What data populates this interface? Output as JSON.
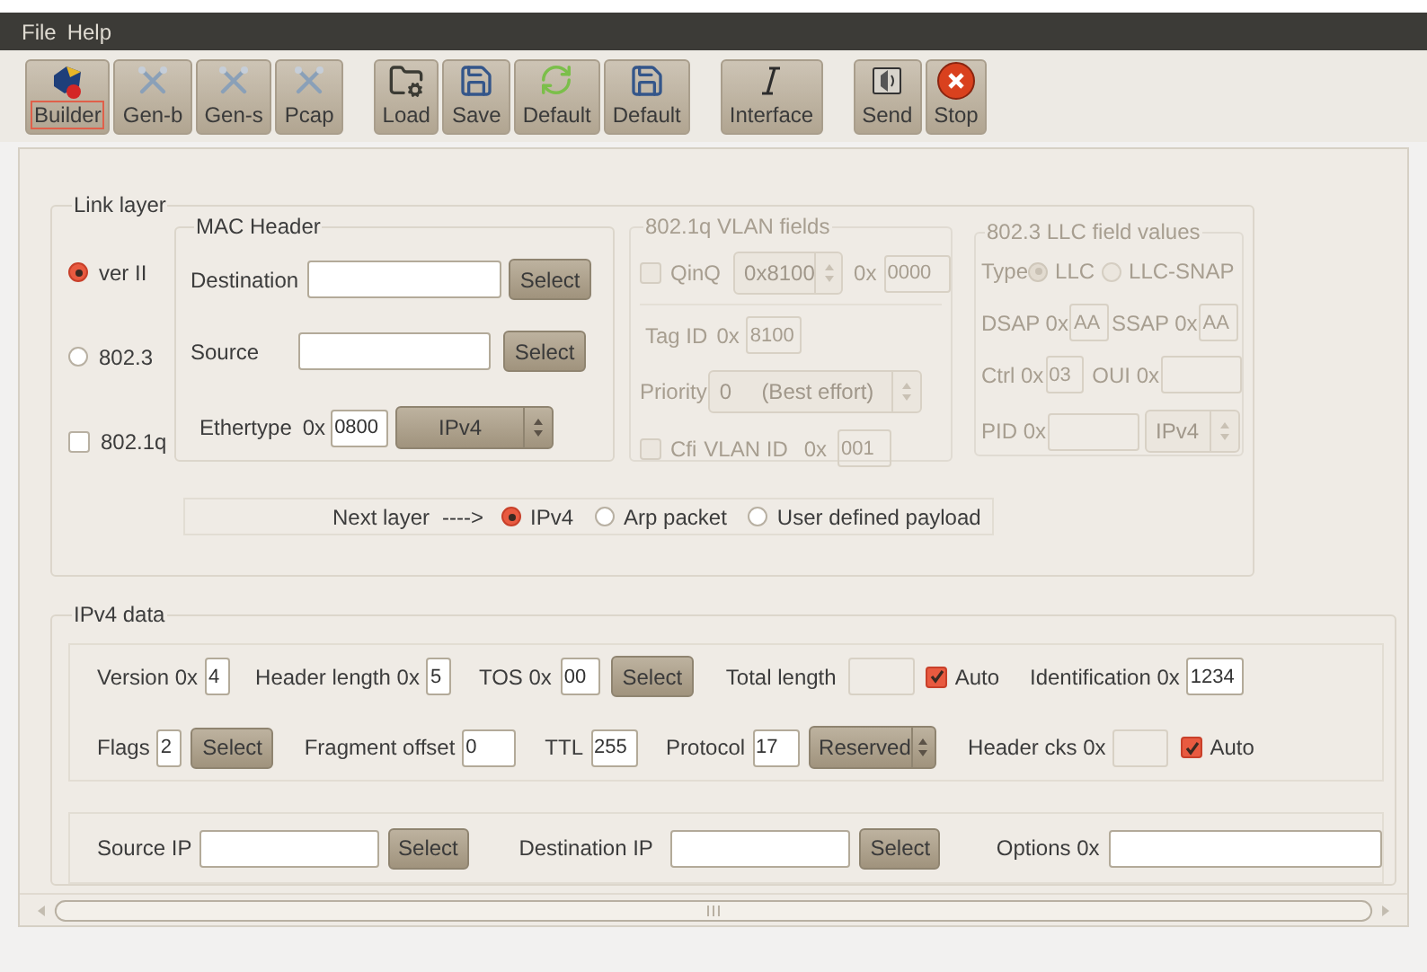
{
  "menu": [
    "File",
    "Help"
  ],
  "toolbar_groups": [
    [
      {
        "label": "Builder",
        "selected": true
      },
      {
        "label": "Gen-b",
        "selected": false
      },
      {
        "label": "Gen-s",
        "selected": false
      },
      {
        "label": "Pcap",
        "selected": false
      }
    ],
    [
      {
        "label": "Load",
        "selected": false
      },
      {
        "label": "Save",
        "selected": false
      },
      {
        "label": "Default",
        "selected": false
      },
      {
        "label": "Default",
        "selected": false
      }
    ],
    [
      {
        "label": "Interface",
        "selected": false
      }
    ],
    [
      {
        "label": "Send",
        "selected": false
      },
      {
        "label": "Stop",
        "selected": false
      }
    ]
  ],
  "link_layer": {
    "title": "Link layer",
    "options": [
      {
        "kind": "radio",
        "label": "ver II",
        "checked": true
      },
      {
        "kind": "radio",
        "label": "802.3",
        "checked": false
      },
      {
        "kind": "checkbox",
        "label": "802.1q",
        "checked": false
      }
    ],
    "mac_header": {
      "title": "MAC Header",
      "destination": {
        "label": "Destination",
        "button": "Select"
      },
      "source": {
        "label": "Source",
        "button": "Select"
      },
      "ethertype": {
        "label": "Ethertype",
        "prefix": "0x",
        "value": "0800",
        "combo": "IPv4"
      }
    },
    "vlan": {
      "title": "802.1q VLAN fields",
      "disabled": true,
      "qinq": {
        "label": "QinQ",
        "checked": false,
        "combo": "0x8100",
        "prefix": "0x",
        "value": "0000"
      },
      "tag_id": {
        "label": "Tag ID",
        "prefix": "0x",
        "value": "8100"
      },
      "priority": {
        "label": "Priority",
        "combo": "0     (Best effort)"
      },
      "cfi": {
        "label": "Cfi",
        "checked": false
      },
      "vlan_id": {
        "label": "VLAN ID",
        "prefix": "0x",
        "value": "001"
      }
    },
    "llc": {
      "title": "802.3 LLC field values",
      "disabled": true,
      "type_label": "Type",
      "types": [
        {
          "label": "LLC",
          "selected": true
        },
        {
          "label": "LLC-SNAP",
          "selected": false
        }
      ],
      "dsap": {
        "label": "DSAP 0x",
        "value": "AA"
      },
      "ssap": {
        "label": "SSAP 0x",
        "value": "AA"
      },
      "ctrl": {
        "label": "Ctrl 0x",
        "value": "03"
      },
      "oui": {
        "label": "OUI 0x"
      },
      "pid": {
        "label": "PID 0x",
        "combo": "IPv4"
      }
    },
    "next_layer": {
      "label": "Next layer",
      "arrow": "---->",
      "options": [
        {
          "label": "IPv4",
          "selected": true
        },
        {
          "label": "Arp packet",
          "selected": false
        },
        {
          "label": "User defined payload",
          "selected": false
        }
      ]
    }
  },
  "ipv4": {
    "title": "IPv4 data",
    "version": {
      "label": "Version 0x",
      "value": "4"
    },
    "header_length": {
      "label": "Header length 0x",
      "value": "5"
    },
    "tos": {
      "label": "TOS 0x",
      "value": "00",
      "button": "Select"
    },
    "total_length": {
      "label": "Total length",
      "auto": {
        "label": "Auto",
        "checked": true
      }
    },
    "identification": {
      "label": "Identification 0x",
      "value": "1234"
    },
    "flags": {
      "label": "Flags",
      "value": "2",
      "button": "Select"
    },
    "fragment_offset": {
      "label": "Fragment offset",
      "value": "0"
    },
    "ttl": {
      "label": "TTL",
      "value": "255"
    },
    "protocol": {
      "label": "Protocol",
      "value": "17",
      "combo": "Reserved"
    },
    "header_cks": {
      "label": "Header cks 0x",
      "auto": {
        "label": "Auto",
        "checked": true
      }
    },
    "source_ip": {
      "label": "Source IP",
      "button": "Select"
    },
    "destination_ip": {
      "label": "Destination IP",
      "button": "Select"
    },
    "options": {
      "label": "Options 0x"
    }
  }
}
